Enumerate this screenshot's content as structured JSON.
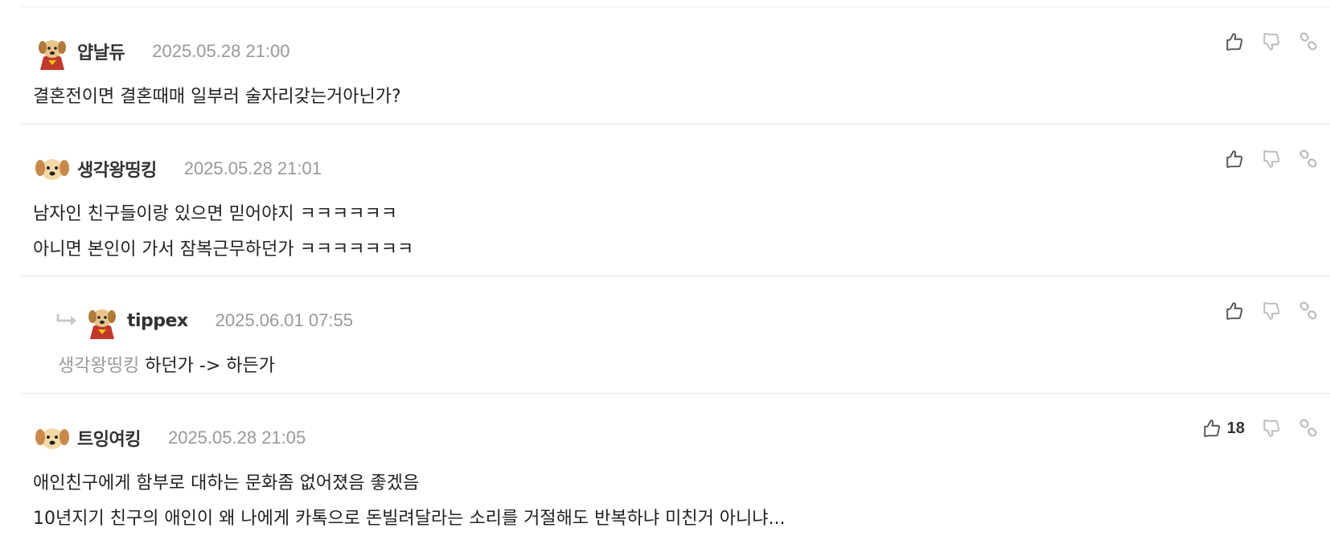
{
  "comments": [
    {
      "author": "얍날듀",
      "date": "2025.05.28 21:00",
      "avatar": "dog-cape-avatar",
      "lines": [
        "결혼전이면 결혼때매 일부러 술자리갖는거아닌가?"
      ],
      "likes": ""
    },
    {
      "author": "생각왕띵킹",
      "date": "2025.05.28 21:01",
      "avatar": "dog-face-avatar",
      "lines": [
        "남자인 친구들이랑 있으면 믿어야지 ㅋㅋㅋㅋㅋㅋ",
        "아니면 본인이 가서 잠복근무하던가 ㅋㅋㅋㅋㅋㅋㅋ"
      ],
      "likes": ""
    },
    {
      "author": "tippex",
      "date": "2025.06.01 07:55",
      "avatar": "dog-cape-avatar",
      "mention": "생각왕띵킹",
      "text": "하던가 -> 하든가",
      "likes": "",
      "is_reply": true
    },
    {
      "author": "트잉여킹",
      "date": "2025.05.28 21:05",
      "avatar": "dog-face-avatar",
      "lines": [
        "애인친구에게 함부로 대하는 문화좀 없어졌음 좋겠음",
        "10년지기 친구의 애인이 왜 나에게 카톡으로 돈빌려달라는 소리를 거절해도 반복하냐 미친거 아니냐..."
      ],
      "likes": "18"
    }
  ],
  "icons": {
    "like": "thumbs-up-icon",
    "dislike": "thumbs-down-icon",
    "link": "link-icon",
    "reply": "reply-arrow-icon"
  },
  "colors": {
    "date": "#999999",
    "mention": "#999999",
    "icon": "#bbbbbb",
    "icon_active": "#555555"
  }
}
